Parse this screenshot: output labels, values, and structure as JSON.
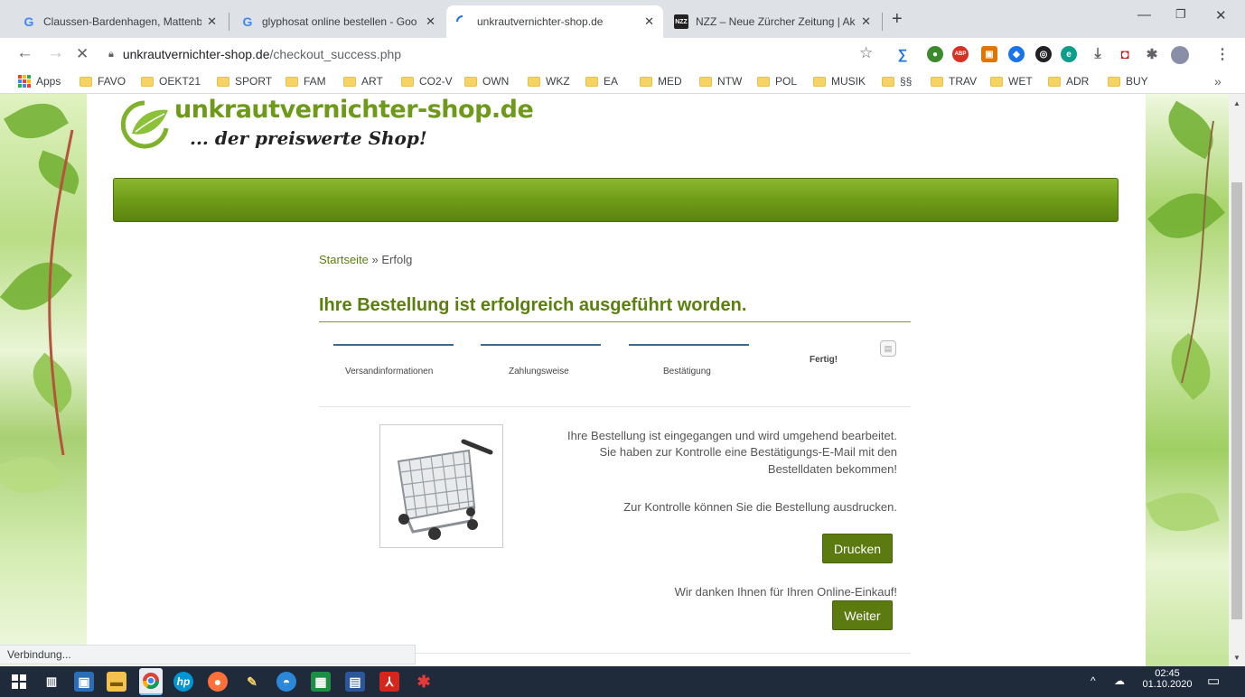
{
  "browser": {
    "tabs": [
      {
        "title": "Claussen-Bardenhagen, Mattenb",
        "favicon": "google-g-icon"
      },
      {
        "title": "glyphosat online bestellen - Goo",
        "favicon": "google-g-icon"
      },
      {
        "title": "unkrautvernichter-shop.de",
        "favicon": "loading-spinner-icon"
      },
      {
        "title": "NZZ – Neue Zürcher Zeitung | Ak",
        "favicon": "nzz-icon"
      }
    ],
    "new_tab": "+",
    "url_domain": "unkrautvernichter-shop.de",
    "url_path": "/checkout_success.php",
    "bookmarks": [
      "FAVO",
      "OEKT21",
      "SPORT",
      "FAM",
      "ART",
      "CO2-V",
      "OWN",
      "WKZ",
      "EA",
      "MED",
      "NTW",
      "POL",
      "MUSIK",
      "§§",
      "TRAV",
      "WET",
      "ADR",
      "BUY"
    ],
    "apps_label": "Apps",
    "more": "»",
    "status": "Verbindung..."
  },
  "shop": {
    "name": "unkrautvernichter-shop.de",
    "tagline": "... der preiswerte Shop!",
    "breadcrumb_home": "Startseite",
    "breadcrumb_sep": " » ",
    "breadcrumb_current": "Erfolg",
    "heading": "Ihre Bestellung ist erfolgreich ausgeführt worden.",
    "steps": [
      "Versandinformationen",
      "Zahlungsweise",
      "Bestätigung",
      "Fertig!"
    ],
    "message_lines": [
      "Ihre Bestellung ist eingegangen und wird umgehend bearbeitet.",
      "Sie haben zur Kontrolle eine Bestätigungs-E-Mail mit den",
      "Bestelldaten bekommen!"
    ],
    "print_hint": "Zur Kontrolle können Sie die Bestellung ausdrucken.",
    "print_button": "Drucken",
    "thanks": "Wir danken Ihnen für Ihren Online-Einkauf!",
    "continue_button": "Weiter",
    "accent_color": "#5b7a0f"
  },
  "taskbar": {
    "time": "02:45",
    "date": "01.10.2020"
  }
}
